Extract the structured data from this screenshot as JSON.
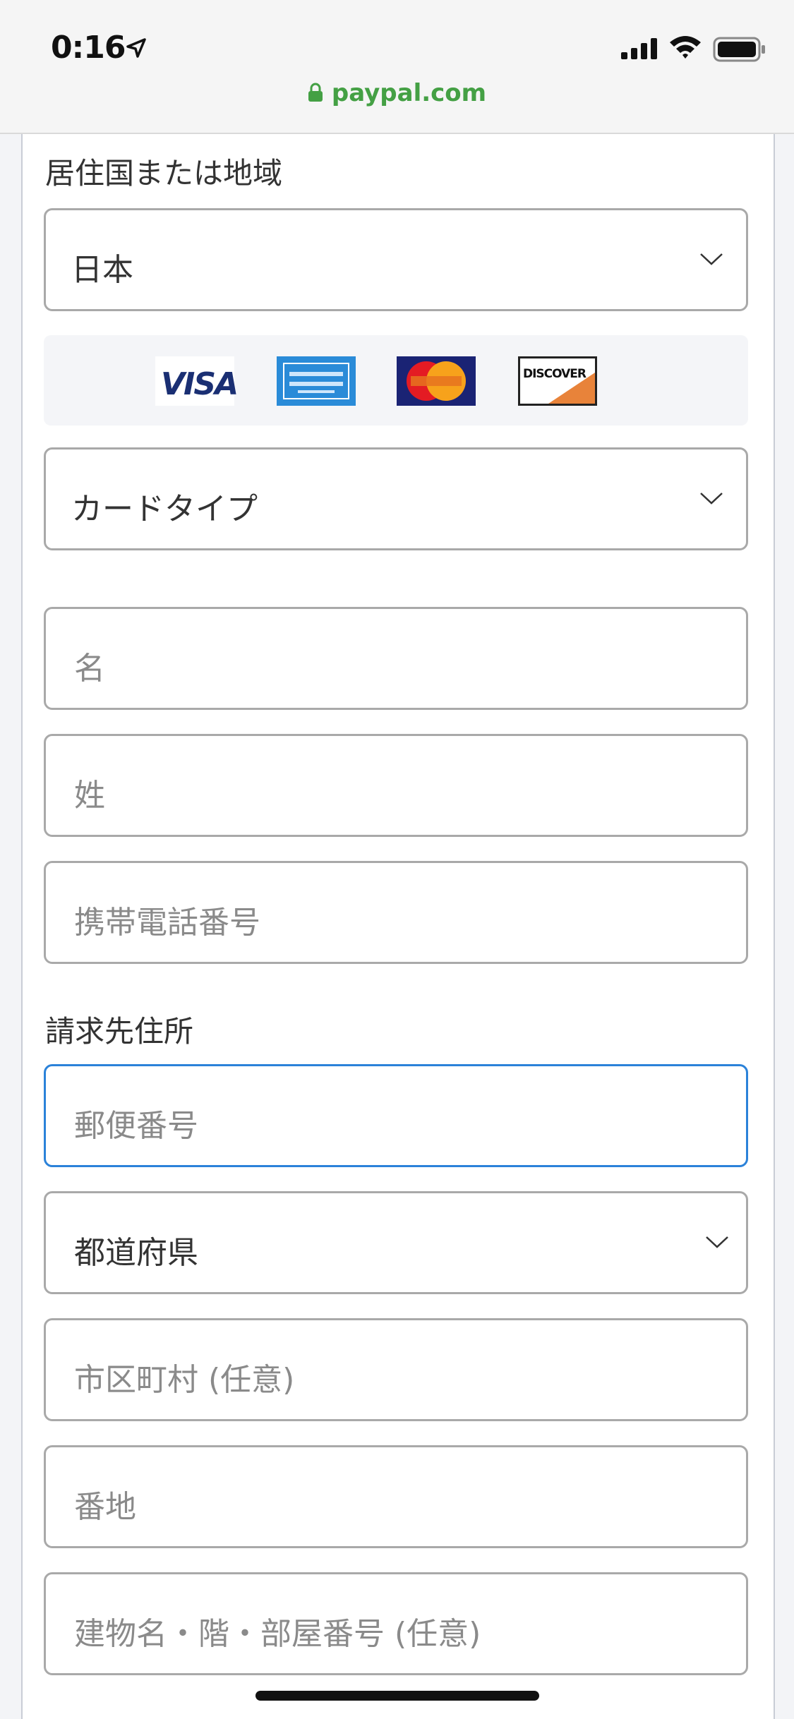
{
  "status_bar": {
    "time": "0:16"
  },
  "browser": {
    "url": "paypal.com"
  },
  "form": {
    "country_label": "居住国または地域",
    "country_value": "日本",
    "card_brands": [
      "VISA",
      "AMERICAN EXPRESS",
      "MasterCard",
      "DISCOVER"
    ],
    "card_type_value": "カードタイプ",
    "first_name_placeholder": "名",
    "last_name_placeholder": "姓",
    "mobile_placeholder": "携帯電話番号",
    "billing_label": "請求先住所",
    "postal_placeholder": "郵便番号",
    "prefecture_value": "都道府県",
    "city_placeholder": "市区町村 (任意)",
    "street_placeholder": "番地",
    "building_placeholder": "建物名・階・部屋番号 (任意)"
  },
  "colors": {
    "focus_border": "#2b82d9",
    "url_green": "#44a044",
    "field_border": "#a9a9a9"
  }
}
